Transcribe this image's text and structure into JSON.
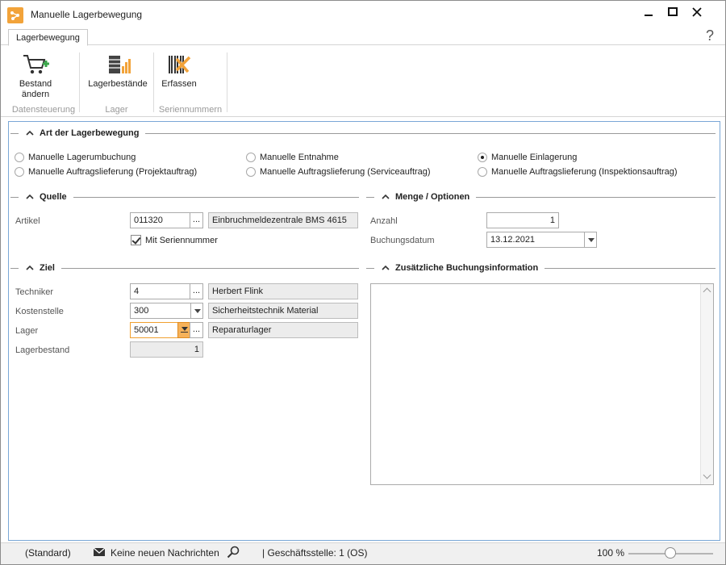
{
  "window": {
    "title": "Manuelle Lagerbewegung"
  },
  "tabs": [
    {
      "label": "Lagerbewegung"
    }
  ],
  "help_glyph": "?",
  "ribbon": {
    "groups": [
      {
        "label": "Datensteuerung",
        "buttons": [
          {
            "line1": "Bestand",
            "line2": "ändern",
            "icon": "cart-add-icon"
          }
        ]
      },
      {
        "label": "Lager",
        "buttons": [
          {
            "line1": "Lagerbestände",
            "icon": "warehouse-stock-icon"
          }
        ]
      },
      {
        "label": "Seriennummern",
        "buttons": [
          {
            "line1": "Erfassen",
            "icon": "barcode-tools-icon"
          }
        ]
      }
    ]
  },
  "sections": {
    "art": "Art der Lagerbewegung",
    "quelle": "Quelle",
    "menge": "Menge / Optionen",
    "ziel": "Ziel",
    "info": "Zusätzliche Buchungsinformation"
  },
  "radios": [
    {
      "label": "Manuelle Lagerumbuchung",
      "selected": false
    },
    {
      "label": "Manuelle Entnahme",
      "selected": false
    },
    {
      "label": "Manuelle Einlagerung",
      "selected": true
    },
    {
      "label": "Manuelle Auftragslieferung (Projektauftrag)",
      "selected": false
    },
    {
      "label": "Manuelle Auftragslieferung (Serviceauftrag)",
      "selected": false
    },
    {
      "label": "Manuelle Auftragslieferung (Inspektionsauftrag)",
      "selected": false
    }
  ],
  "quelle": {
    "artikel_label": "Artikel",
    "artikel_value": "011320",
    "artikel_desc": "Einbruchmeldezentrale BMS 4615",
    "serial_label": "Mit Seriennummer",
    "serial_checked": true,
    "ellipsis": "..."
  },
  "menge": {
    "anzahl_label": "Anzahl",
    "anzahl_value": "1",
    "datum_label": "Buchungsdatum",
    "datum_value": "13.12.2021"
  },
  "ziel": {
    "techniker_label": "Techniker",
    "techniker_value": "4",
    "techniker_name": "Herbert Flink",
    "kostenstelle_label": "Kostenstelle",
    "kostenstelle_value": "300",
    "kostenstelle_desc": "Sicherheitstechnik Material",
    "lager_label": "Lager",
    "lager_value": "50001",
    "lager_desc": "Reparaturlager",
    "bestand_label": "Lagerbestand",
    "bestand_value": "1",
    "ellipsis": "..."
  },
  "status": {
    "profile": "(Standard)",
    "messages": "Keine neuen Nachrichten",
    "branch": "| Geschäftsstelle:  1 (OS)",
    "zoom": "100 %"
  },
  "colors": {
    "accent": "#f2a33a",
    "panel_border": "#7aa7d6"
  }
}
